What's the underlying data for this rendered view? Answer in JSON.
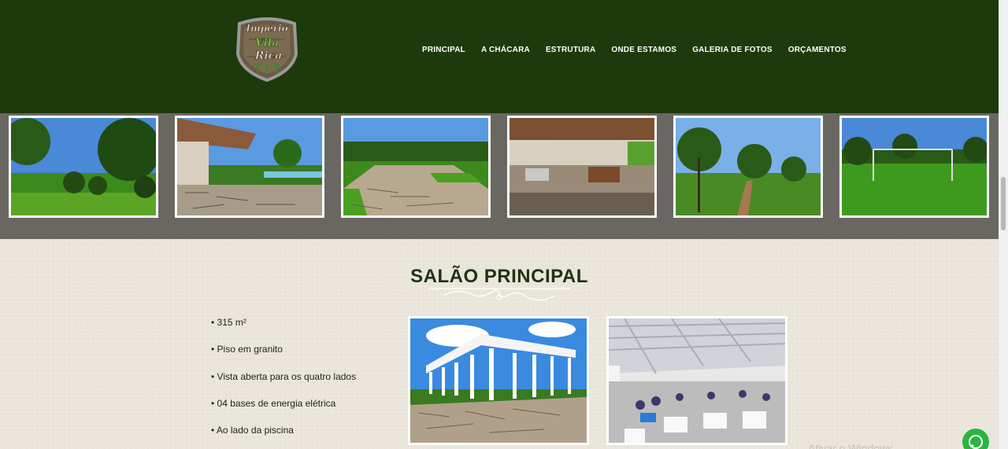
{
  "logo": {
    "line1": "Império",
    "line2": "Vila",
    "line3": "Rica"
  },
  "nav": {
    "items": [
      {
        "label": "PRINCIPAL"
      },
      {
        "label": "A CHÁCARA"
      },
      {
        "label": "ESTRUTURA"
      },
      {
        "label": "ONDE ESTAMOS"
      },
      {
        "label": "GALERIA DE FOTOS"
      },
      {
        "label": "ORÇAMENTOS"
      }
    ]
  },
  "gallery": {
    "photos": [
      "trees-lawn-photo",
      "gazebo-pool-photo",
      "stone-pathway-photo",
      "covered-kitchen-photo",
      "tree-lined-road-photo",
      "soccer-field-photo"
    ]
  },
  "section": {
    "title_light": "SALÃO",
    "title_bold": "PRINCIPAL",
    "features": [
      "315 m²",
      "Piso em granito",
      "Vista aberta para os quatro lados",
      "04 bases de energia elétrica",
      "Ao lado da piscina"
    ]
  },
  "colors": {
    "header_bg": "#1d3a0c",
    "gallery_bg": "#6a6763",
    "section_bg": "#ebe7dd",
    "title": "#1f3310",
    "whatsapp": "#2ab540"
  },
  "watermark": "Ativar o Windows"
}
